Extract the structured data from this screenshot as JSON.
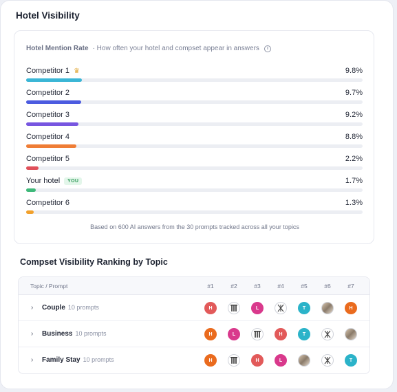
{
  "section1": {
    "title": "Hotel Visibility",
    "card_label": "Hotel Mention Rate",
    "card_sub": "· How often your hotel and compset appear in answers",
    "rows": [
      {
        "name": "Competitor 1",
        "pct": "9.8%",
        "value": 9.8,
        "color": "#3bb6d6"
      },
      {
        "name": "Competitor 2",
        "pct": "9.7%",
        "value": 9.7,
        "color": "#4c5be0"
      },
      {
        "name": "Competitor 3",
        "pct": "9.2%",
        "value": 9.2,
        "color": "#7756e0"
      },
      {
        "name": "Competitor 4",
        "pct": "8.8%",
        "value": 8.8,
        "color": "#ef7d36"
      },
      {
        "name": "Competitor 5",
        "pct": "2.2%",
        "value": 2.2,
        "color": "#e0505a"
      },
      {
        "name": "Your hotel",
        "pct": "1.7%",
        "value": 1.7,
        "color": "#3fb97a",
        "badge": "YOU"
      },
      {
        "name": "Competitor 6",
        "pct": "1.3%",
        "value": 1.3,
        "color": "#f2a12c"
      }
    ],
    "footnote": "Based on 600 AI answers from the 30 prompts tracked across all your topics"
  },
  "section2": {
    "title": "Compset Visibility Ranking by Topic",
    "col_topic": "Topic / Prompt",
    "ranks": [
      "#1",
      "#2",
      "#3",
      "#4",
      "#5",
      "#6",
      "#7"
    ],
    "topics": [
      {
        "name": "Couple",
        "count": "10 prompts",
        "avatars": [
          [
            "H",
            "av-H-red",
            "letter-h-avatar"
          ],
          [
            "",
            "av-pillar",
            "pillar-logo-icon"
          ],
          [
            "L",
            "av-L",
            "letter-l-avatar"
          ],
          [
            "",
            "av-x",
            "x-logo-icon"
          ],
          [
            "T",
            "av-T",
            "letter-t-avatar"
          ],
          [
            "",
            "av-photo",
            "hotel-photo-avatar"
          ],
          [
            "H",
            "av-H-orange",
            "letter-h-avatar"
          ]
        ]
      },
      {
        "name": "Business",
        "count": "10 prompts",
        "avatars": [
          [
            "H",
            "av-H-orange",
            "letter-h-avatar"
          ],
          [
            "L",
            "av-L",
            "letter-l-avatar"
          ],
          [
            "",
            "av-pillar",
            "pillar-logo-icon"
          ],
          [
            "H",
            "av-H-red",
            "letter-h-avatar"
          ],
          [
            "T",
            "av-T",
            "letter-t-avatar"
          ],
          [
            "",
            "av-x",
            "x-logo-icon"
          ],
          [
            "",
            "av-photo",
            "hotel-photo-avatar"
          ]
        ]
      },
      {
        "name": "Family Stay",
        "count": "10 prompts",
        "avatars": [
          [
            "H",
            "av-H-orange",
            "letter-h-avatar"
          ],
          [
            "",
            "av-pillar",
            "pillar-logo-icon"
          ],
          [
            "H",
            "av-H-red",
            "letter-h-avatar"
          ],
          [
            "L",
            "av-L",
            "letter-l-avatar"
          ],
          [
            "",
            "av-photo",
            "hotel-photo-avatar"
          ],
          [
            "",
            "av-x",
            "x-logo-icon"
          ],
          [
            "T",
            "av-T",
            "letter-t-avatar"
          ]
        ]
      }
    ]
  }
}
